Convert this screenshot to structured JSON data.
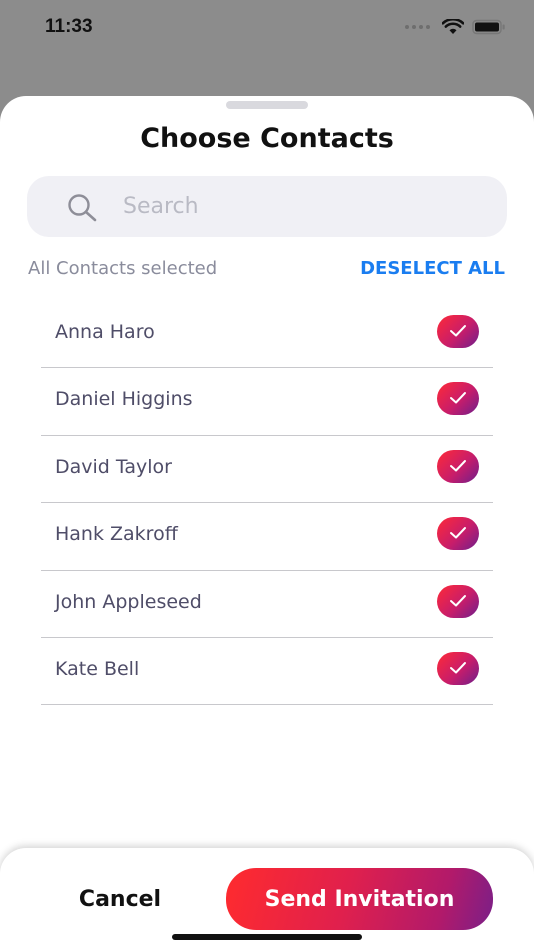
{
  "status_bar": {
    "time": "11:33"
  },
  "sheet": {
    "title": "Choose Contacts",
    "search": {
      "placeholder": "Search",
      "value": "",
      "icon": "search-icon"
    },
    "selection_status": "All Contacts selected",
    "deselect_all_label": "DESELECT ALL",
    "contacts": [
      {
        "name": "Anna Haro",
        "selected": true
      },
      {
        "name": "Daniel Higgins",
        "selected": true
      },
      {
        "name": "David Taylor",
        "selected": true
      },
      {
        "name": "Hank Zakroff",
        "selected": true
      },
      {
        "name": "John Appleseed",
        "selected": true
      },
      {
        "name": "Kate Bell",
        "selected": true
      }
    ]
  },
  "footer": {
    "cancel_label": "Cancel",
    "send_label": "Send Invitation"
  },
  "colors": {
    "accent_link": "#1a7df0",
    "gradient_start": "#ff2b2e",
    "gradient_end": "#7a1f88"
  }
}
